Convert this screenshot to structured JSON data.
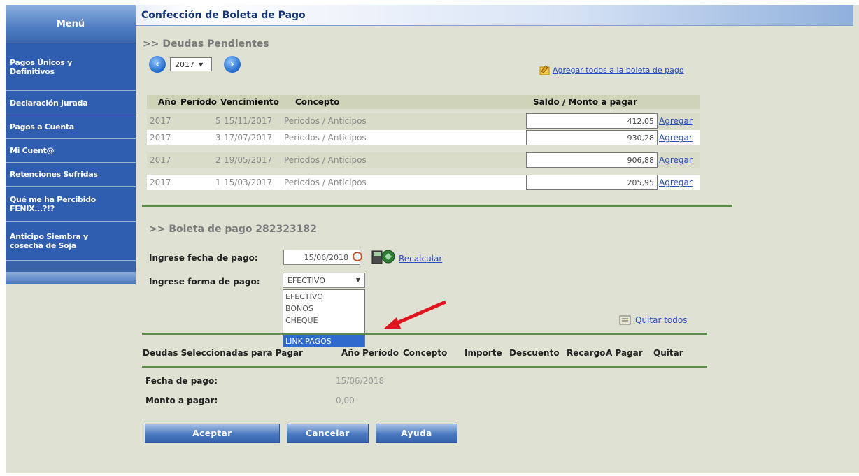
{
  "sidebar": {
    "header": "Menú",
    "items": [
      {
        "label": "Pagos Únicos y Definitivos"
      },
      {
        "label": "Declaración Jurada"
      },
      {
        "label": "Pagos a Cuenta"
      },
      {
        "label": "Mi Cuent@"
      },
      {
        "label": "Retenciones Sufridas"
      },
      {
        "label": "Qué me ha Percibido FENIX...?!?"
      },
      {
        "label": "Anticipo Siembra y cosecha de Soja"
      }
    ]
  },
  "page_title": "Confección de Boleta de Pago",
  "pending": {
    "title": ">> Deudas Pendientes",
    "year": "2017",
    "add_all_link": "Agregar todos a la boleta de pago",
    "headers": {
      "ano": "Año",
      "periodo": "Período",
      "vencimiento": "Vencimiento",
      "concepto": "Concepto",
      "saldo": "Saldo / Monto a pagar"
    },
    "rows": [
      {
        "ano": "2017",
        "periodo": "5",
        "vencimiento": "15/11/2017",
        "concepto": "Periodos / Anticipos",
        "monto": "412,05",
        "action": "Agregar"
      },
      {
        "ano": "2017",
        "periodo": "3",
        "vencimiento": "17/07/2017",
        "concepto": "Periodos / Anticipos",
        "monto": "930,28",
        "action": "Agregar"
      },
      {
        "ano": "2017",
        "periodo": "2",
        "vencimiento": "19/05/2017",
        "concepto": "Periodos / Anticipos",
        "monto": "906,88",
        "action": "Agregar"
      },
      {
        "ano": "2017",
        "periodo": "1",
        "vencimiento": "15/03/2017",
        "concepto": "Periodos / Anticipos",
        "monto": "205,95",
        "action": "Agregar"
      }
    ]
  },
  "boleta": {
    "title": ">> Boleta de pago 282323182",
    "fecha_label": "Ingrese fecha de pago:",
    "fecha_value": "15/06/2018",
    "recalc_link": "Recalcular",
    "forma_label": "Ingrese forma de pago:",
    "forma_selected": "EFECTIVO",
    "forma_options": [
      "EFECTIVO",
      "BONOS",
      "CHEQUE",
      "LINK PAGOS"
    ],
    "quitar_todos": "Quitar todos"
  },
  "selected": {
    "title": "Deudas Seleccionadas para Pagar",
    "headers": [
      "Año",
      "Período",
      "Concepto",
      "Importe",
      "Descuento",
      "Recargo",
      "A Pagar",
      "Quitar"
    ]
  },
  "summary": {
    "fecha_label": "Fecha de pago:",
    "fecha_value": "15/06/2018",
    "monto_label": "Monto a pagar:",
    "monto_value": "0,00"
  },
  "buttons": {
    "aceptar": "Aceptar",
    "cancelar": "Cancelar",
    "ayuda": "Ayuda"
  },
  "colors": {
    "sidebar": "#2f5db0",
    "accent_arrow": "#e0141e",
    "rule": "#5e8a4d"
  }
}
